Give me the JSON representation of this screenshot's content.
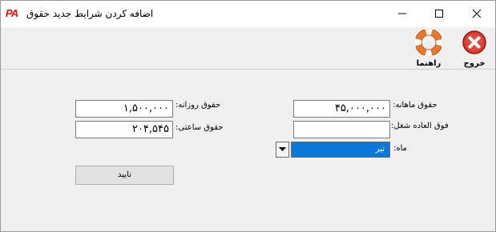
{
  "window": {
    "app_logo": "PA",
    "title": "اضافه کردن شرایط جدید حقوق"
  },
  "toolbar": {
    "exit_label": "خروج",
    "help_label": "راهنما"
  },
  "form": {
    "monthly_salary_label": "حقوق ماهانه:",
    "monthly_salary_value": "۴۵,۰۰۰,۰۰۰",
    "daily_salary_label": "حقوق روزانه:",
    "daily_salary_value": "۱,۵۰۰,۰۰۰",
    "overtime_label": "فوق العاده شغل:",
    "overtime_value": "",
    "hourly_salary_label": "حقوق ساعتی:",
    "hourly_salary_value": "۲۰۴,۵۴۵",
    "month_label": "ماه:",
    "month_value": "تیر",
    "submit_label": "تایید"
  },
  "colors": {
    "selection": "#0a78d7",
    "exit_red": "#d83a2e",
    "help_orange": "#e8782a"
  }
}
